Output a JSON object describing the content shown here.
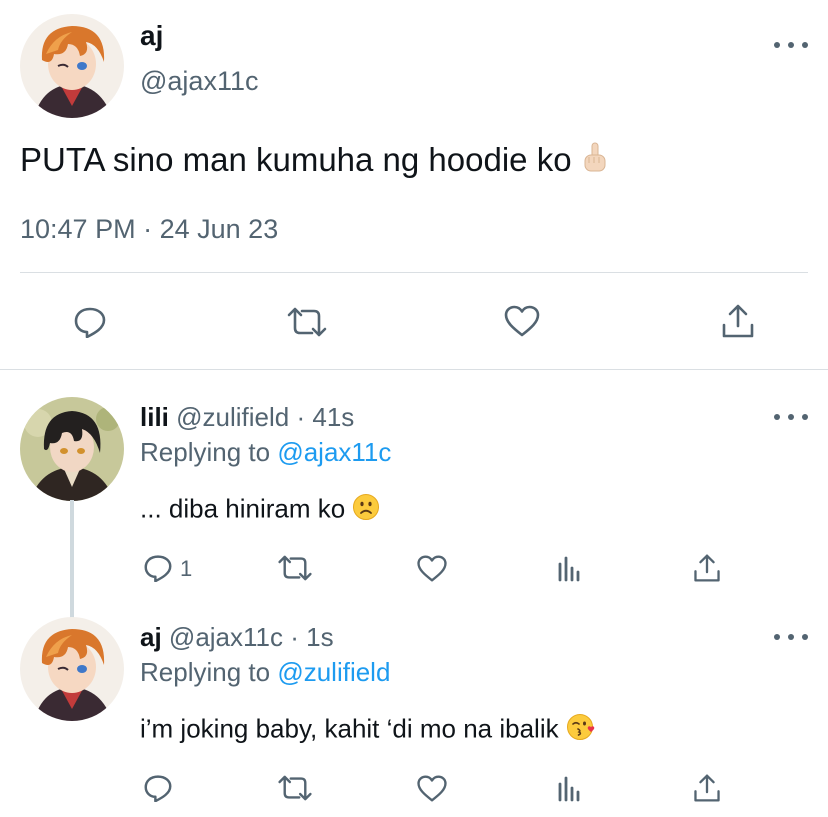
{
  "main_tweet": {
    "name": "aj",
    "handle": "@ajax11c",
    "text": "PUTA sino man kumuha ng hoodie ko",
    "time": "10:47 PM",
    "separator": "·",
    "date": "24 Jun 23",
    "emoji_icon": "middle-finger-emoji-icon"
  },
  "replies": [
    {
      "name": "lili",
      "handle": "@zulifield",
      "separator": "·",
      "age": "41s",
      "replying_prefix": "Replying to",
      "replying_to": "@ajax11c",
      "text": "... diba hiniram ko",
      "emoji_icon": "slightly-frowning-face-emoji-icon",
      "reply_count": "1"
    },
    {
      "name": "aj",
      "handle": "@ajax11c",
      "separator": "·",
      "age": "1s",
      "replying_prefix": "Replying to",
      "replying_to": "@zulifield",
      "text": "i’m joking baby, kahit ‘di mo na ibalik",
      "emoji_icon": "face-blowing-kiss-emoji-icon"
    }
  ],
  "colors": {
    "text": "#0f1419",
    "secondary": "#536471",
    "link": "#1d9bf0",
    "divider": "#dadfe3"
  }
}
